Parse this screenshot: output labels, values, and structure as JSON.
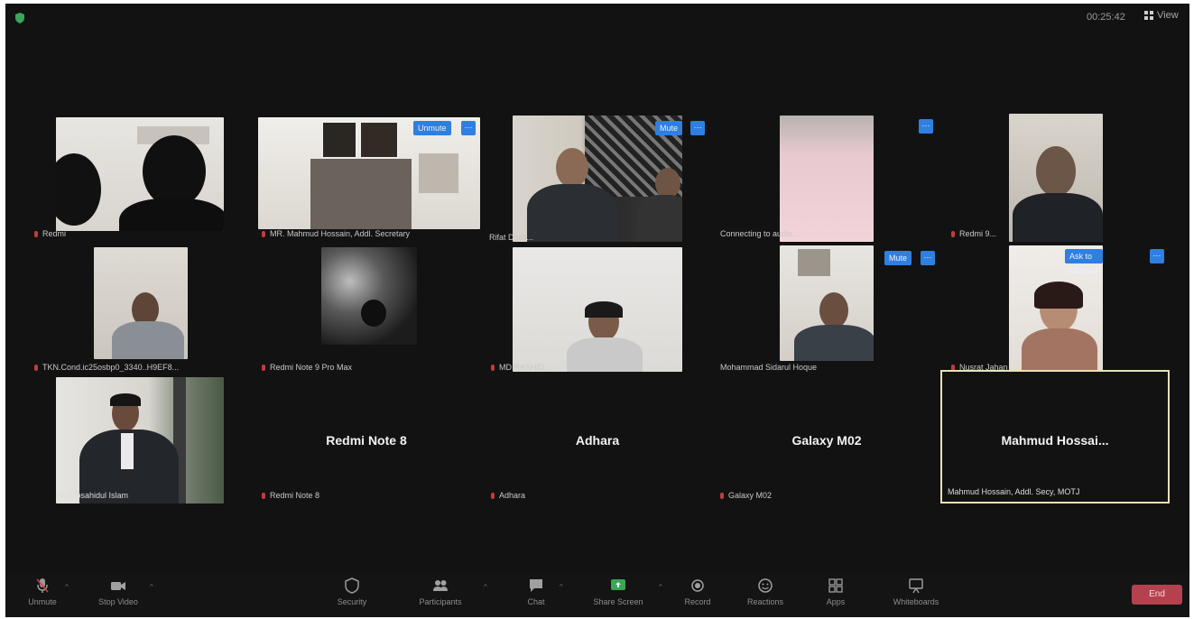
{
  "meeting": {
    "timer": "00:25:42",
    "view_label": "View"
  },
  "tiles": {
    "t1": {
      "name": "Redmi"
    },
    "t2": {
      "name": "MR. Mahmud Hossain, Addl. Secretary",
      "unmute": "Unmute",
      "more": "···"
    },
    "t3": {
      "name": "Rifat Dhali...",
      "mute": "Mute",
      "more": "···"
    },
    "t4": {
      "name": "Connecting to audio...",
      "more": "···"
    },
    "t5": {
      "name": "Redmi 9..."
    },
    "t6": {
      "name": "TKN.Cond.ic25osbp0_3340..H9EF8..."
    },
    "t7": {
      "name": "Redmi Note 9 Pro Max"
    },
    "t8": {
      "name": "MD RASHID..."
    },
    "t9": {
      "name": "Mohammad Sidarul Hoque",
      "mute": "Mute",
      "more": "···"
    },
    "t10": {
      "name": "Nusrat Jahan",
      "ask_unmute": "Ask to Unmute",
      "more": "···"
    },
    "t11": {
      "name": "Md Mosahidul Islam"
    },
    "t12": {
      "name": "Redmi Note 8",
      "label": "Redmi Note 8"
    },
    "t13": {
      "name": "Adhara",
      "label": "Adhara"
    },
    "t14": {
      "name": "Galaxy M02",
      "label": "Galaxy M02"
    },
    "t15": {
      "name": "Mahmud Hossain, Addl. Secy, MOTJ",
      "label": "Mahmud  Hossai..."
    }
  },
  "toolbar": {
    "unmute": "Unmute",
    "stop_video": "Stop Video",
    "security": "Security",
    "participants": "Participants",
    "chat": "Chat",
    "share_screen": "Share Screen",
    "record": "Record",
    "reactions": "Reactions",
    "apps": "Apps",
    "whiteboards": "Whiteboards",
    "end": "End"
  },
  "colors": {
    "background": "#121212",
    "accent_blue": "#2f7fe0",
    "end_red": "#b5414e",
    "active_speaker": "#e9e3b0"
  }
}
